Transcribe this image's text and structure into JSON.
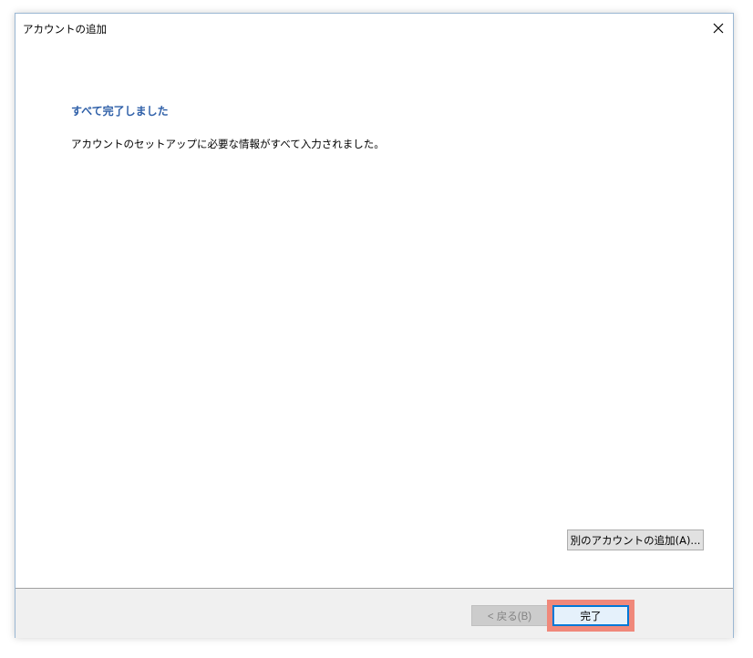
{
  "window": {
    "title": "アカウントの追加",
    "close_icon": "close-icon"
  },
  "content": {
    "heading": "すべて完了しました",
    "message": "アカウントのセットアップに必要な情報がすべて入力されました。",
    "add_another_label": "別のアカウントの追加(A)..."
  },
  "footer": {
    "back_label": "< 戻る(B)",
    "back_enabled": false,
    "finish_label": "完了",
    "finish_highlight_color": "#f0887a"
  },
  "colors": {
    "heading": "#2e5fa8",
    "accent": "#0078d7"
  }
}
